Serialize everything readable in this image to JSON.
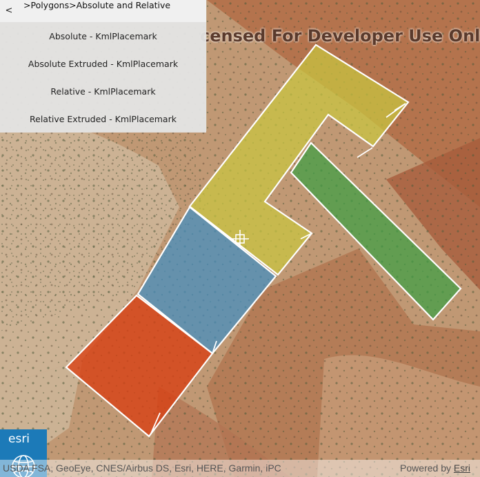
{
  "map": {
    "watermark": "censed For Developer Use Only",
    "polygons": [
      {
        "name": "absolute",
        "color": "#c9c640"
      },
      {
        "name": "absolute-extruded",
        "color": "#3aa043"
      },
      {
        "name": "relative",
        "color": "#3e8fc4"
      },
      {
        "name": "relative-extruded",
        "color": "#d83f12"
      }
    ]
  },
  "panel": {
    "back_label": "<",
    "breadcrumb": ">Polygons>Absolute and Relative",
    "items": [
      {
        "label": "Absolute - KmlPlacemark"
      },
      {
        "label": "Absolute Extruded - KmlPlacemark"
      },
      {
        "label": "Relative - KmlPlacemark"
      },
      {
        "label": "Relative Extruded - KmlPlacemark"
      }
    ]
  },
  "logo": {
    "text": "esri",
    "color": "#1c7ab8"
  },
  "attribution": {
    "sources": "USDA FSA, GeoEye, CNES/Airbus DS, Esri, HERE, Garmin, iPC",
    "powered_prefix": "Powered by ",
    "powered_link": "Esri"
  }
}
